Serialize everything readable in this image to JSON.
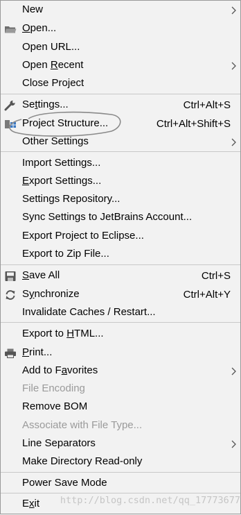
{
  "menu": {
    "items": [
      {
        "id": "new",
        "label": "New",
        "submenu": true
      },
      {
        "id": "open",
        "label": "Open...",
        "mnemonic": "O",
        "icon": "folder-icon"
      },
      {
        "id": "open_url",
        "label": "Open URL..."
      },
      {
        "id": "open_recent",
        "label": "Open Recent",
        "mnemonic": "R",
        "submenu": true
      },
      {
        "id": "close_project",
        "label": "Close Project"
      },
      {
        "id": "settings",
        "label": "Settings...",
        "mnemonic": "t",
        "shortcut": "Ctrl+Alt+S",
        "icon": "wrench-icon"
      },
      {
        "id": "project_structure",
        "label": "Project Structure...",
        "shortcut": "Ctrl+Alt+Shift+S",
        "icon": "project-structure-icon"
      },
      {
        "id": "other_settings",
        "label": "Other Settings",
        "submenu": true
      },
      {
        "id": "import_settings",
        "label": "Import Settings..."
      },
      {
        "id": "export_settings",
        "label": "Export Settings...",
        "mnemonic": "E"
      },
      {
        "id": "settings_repo",
        "label": "Settings Repository..."
      },
      {
        "id": "sync_settings",
        "label": "Sync Settings to JetBrains Account..."
      },
      {
        "id": "export_eclipse",
        "label": "Export Project to Eclipse..."
      },
      {
        "id": "export_zip",
        "label": "Export to Zip File..."
      },
      {
        "id": "save_all",
        "label": "Save All",
        "mnemonic": "S",
        "shortcut": "Ctrl+S",
        "icon": "save-icon"
      },
      {
        "id": "synchronize",
        "label": "Synchronize",
        "mnemonic": "y",
        "shortcut": "Ctrl+Alt+Y",
        "icon": "sync-icon"
      },
      {
        "id": "invalidate",
        "label": "Invalidate Caches / Restart..."
      },
      {
        "id": "export_html",
        "label": "Export to HTML...",
        "mnemonic": "H"
      },
      {
        "id": "print",
        "label": "Print...",
        "mnemonic": "P",
        "icon": "printer-icon"
      },
      {
        "id": "add_favorites",
        "label": "Add to Favorites",
        "mnemonic": "a",
        "submenu": true
      },
      {
        "id": "file_encoding",
        "label": "File Encoding",
        "disabled": true
      },
      {
        "id": "remove_bom",
        "label": "Remove BOM"
      },
      {
        "id": "associate",
        "label": "Associate with File Type...",
        "disabled": true
      },
      {
        "id": "line_sep",
        "label": "Line Separators",
        "submenu": true
      },
      {
        "id": "make_readonly",
        "label": "Make Directory Read-only"
      },
      {
        "id": "power_save",
        "label": "Power Save Mode"
      },
      {
        "id": "exit",
        "label": "Exit",
        "mnemonic": "x"
      }
    ]
  },
  "watermark": "http://blog.csdn.net/qq_17773677"
}
